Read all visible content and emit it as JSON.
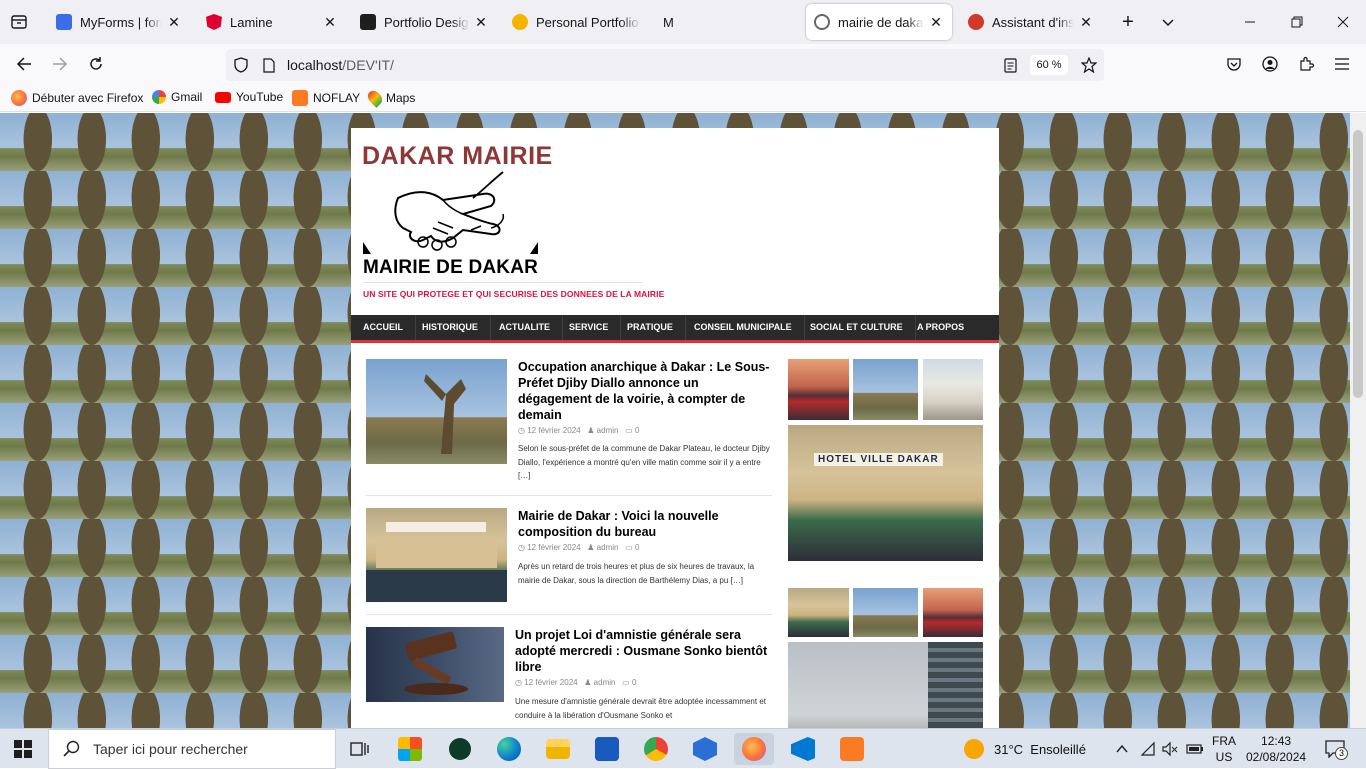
{
  "browser": {
    "tabs": [
      {
        "title": "MyForms | forms.",
        "favicon_color": "#3a6ee8"
      },
      {
        "title": "Lamine",
        "favicon_color": "#dd0031"
      },
      {
        "title": "Portfolio Design (",
        "favicon_color": "#1e1e1e"
      },
      {
        "title": "Personal Portfolio",
        "favicon_color": "#f4b400"
      },
      {
        "title": "M",
        "favicon_color": ""
      },
      {
        "title": "mairie de dakar –",
        "favicon_color": "#666666"
      },
      {
        "title": "Assistant d'install",
        "favicon_color": "#d03a2b"
      }
    ],
    "url_host": "localhost",
    "url_path": "/DEV'IT/",
    "zoom": "60 %",
    "bookmarks": [
      {
        "label": "Débuter avec Firefox",
        "icon": "firefox-icon"
      },
      {
        "label": "Gmail",
        "icon": "google-icon"
      },
      {
        "label": "YouTube",
        "icon": "youtube-icon"
      },
      {
        "label": "NOFLAY",
        "icon": "xampp-icon"
      },
      {
        "label": "Maps",
        "icon": "maps-icon"
      }
    ]
  },
  "site": {
    "logo_text": "DAKAR MAIRIE",
    "title": "MAIRIE DE DAKAR",
    "tagline": "UN SITE QUI PROTEGE ET QUI SECURISE DES DONNEES DE LA MAIRIE",
    "menu": [
      "ACCUEIL",
      "HISTORIQUE",
      "ACTUALITE",
      "SERVICE",
      "PRATIQUE",
      "CONSEIL MUNICIPALE",
      "SOCIAL ET CULTURE",
      "A PROPOS"
    ],
    "posts": [
      {
        "title": "Occupation anarchique à Dakar : Le Sous-Préfet Djiby Diallo annonce un dégagement de la voirie, à compter de demain",
        "date": "12 février 2024",
        "author": "admin",
        "comments": "0",
        "excerpt": "Selon le sous-préfet de la commune de Dakar Plateau, le docteur Djiby Diallo, l'expérience a montré qu'en ville matin comme soir il y a entre […]"
      },
      {
        "title": "Mairie de Dakar : Voici la nouvelle composition du bureau",
        "date": "12 février 2024",
        "author": "admin",
        "comments": "0",
        "excerpt": "Après un retard de trois heures et plus de six heures de travaux, la mairie de Dakar, sous la direction de Barthélemy Dias, a pu […]"
      },
      {
        "title": "Un projet Loi d'amnistie générale sera adopté mercredi : Ousmane Sonko bientôt libre",
        "date": "12 février 2024",
        "author": "admin",
        "comments": "0",
        "excerpt": "Une mesure d'amnistie générale devrait être adoptée incessamment et conduire à la libération d'Ousmane Sonko et"
      }
    ],
    "hotel_sign": "HOTEL VILLE DAKAR"
  },
  "taskbar": {
    "search_placeholder": "Taper ici pour rechercher",
    "temperature": "31°C",
    "weather": "Ensoleillé",
    "lang_top": "FRA",
    "lang_bottom": "US",
    "time": "12:43",
    "date": "02/08/2024",
    "notifications": "3"
  }
}
